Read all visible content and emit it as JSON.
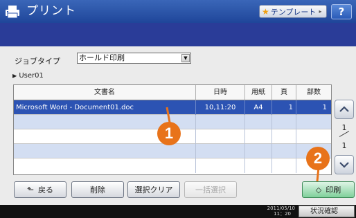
{
  "header": {
    "title": "プリント",
    "template_label": "テンプレート",
    "help_label": "?"
  },
  "jobtype": {
    "label": "ジョブタイプ",
    "selected": "ホールド印刷"
  },
  "user": {
    "name": "User01"
  },
  "table": {
    "columns": [
      "文書名",
      "日時",
      "用紙",
      "頁",
      "部数"
    ],
    "rows": [
      {
        "name": "Microsoft Word - Document01.doc",
        "datetime": "10,11:20",
        "paper": "A4",
        "pages": "1",
        "copies": "1",
        "selected": true
      }
    ]
  },
  "pager": {
    "current": "1",
    "total": "1"
  },
  "buttons": {
    "back": "戻る",
    "delete": "削除",
    "clear_selection": "選択クリア",
    "select_all": "一括選択",
    "print": "印刷"
  },
  "status": {
    "date": "2011/05/10",
    "time": "11：20",
    "button": "状況確認"
  },
  "callouts": [
    "1",
    "2"
  ],
  "colors": {
    "header": "#2c56ad",
    "subbar": "#2a3c98",
    "selected_row": "#2c53b3",
    "alt_row": "#d3def2",
    "print_button": "#7fd09a",
    "callout": "#e8731a"
  }
}
